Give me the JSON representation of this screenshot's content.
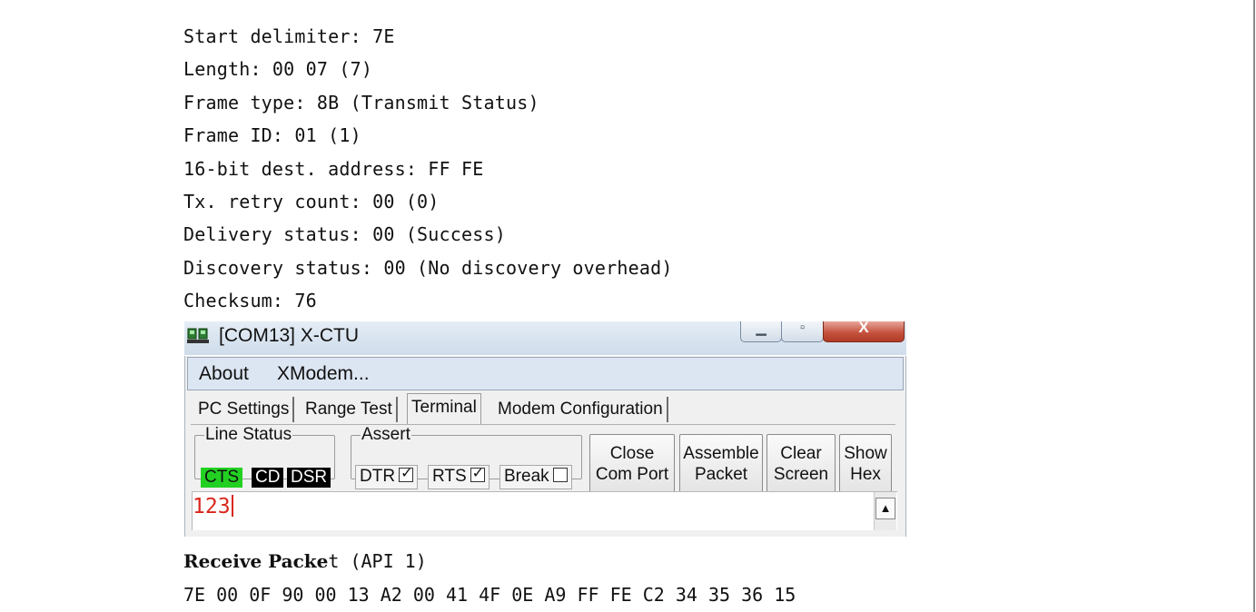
{
  "doc": {
    "lines": [
      "Start delimiter: 7E",
      "Length: 00 07 (7)",
      "Frame type: 8B (Transmit Status)",
      "Frame ID: 01 (1)",
      "16-bit dest. address: FF FE",
      "Tx. retry count: 00 (0)",
      "Delivery status: 00 (Success)",
      "Discovery status: 00 (No discovery overhead)",
      "Checksum: 76"
    ],
    "receive_title_bold": "Receive Packe",
    "receive_title_rest": "t (API 1)",
    "receive_bytes": "7E 00 0F 90 00 13 A2 00 41 4F 0E A9 FF FE C2 34 35 36 15"
  },
  "window": {
    "title": "[COM13] X-CTU",
    "icon": "xctu-app-icon",
    "controls": {
      "minimize": "minimize-icon",
      "maximize": "maximize-icon",
      "close": "close-icon"
    }
  },
  "menu": {
    "about": "About",
    "xmodem": "XModem..."
  },
  "tabs": {
    "pc_settings": "PC Settings",
    "range_test": "Range Test",
    "terminal": "Terminal",
    "modem_config": "Modem Configuration",
    "active": "Terminal"
  },
  "line_status": {
    "legend": "Line Status",
    "cts": "CTS",
    "cd": "CD",
    "dsr": "DSR",
    "cts_on": true,
    "cd_on": false,
    "dsr_on": false
  },
  "assert": {
    "legend": "Assert",
    "dtr": "DTR",
    "rts": "RTS",
    "break": "Break",
    "dtr_checked": true,
    "rts_checked": true,
    "break_checked": false
  },
  "buttons": {
    "close_com_port": [
      "Close",
      "Com Port"
    ],
    "assemble_packet": [
      "Assemble",
      "Packet"
    ],
    "clear_screen": [
      "Clear",
      "Screen"
    ],
    "show_hex": [
      "Show",
      "Hex"
    ]
  },
  "terminal": {
    "text": "123"
  },
  "colors": {
    "led_on": "#22d022",
    "terminal_text": "#d9261c",
    "menubar": "#dce5f2"
  }
}
